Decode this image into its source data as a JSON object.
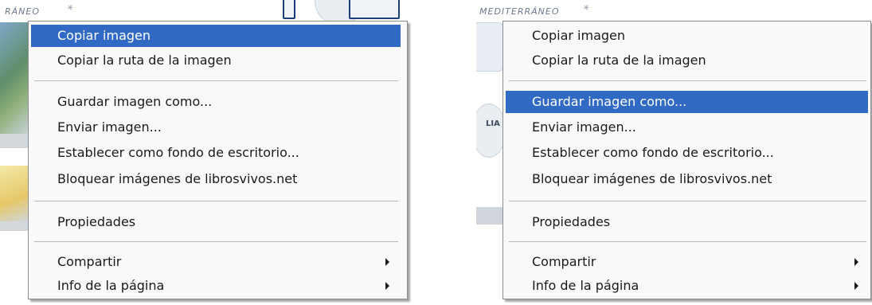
{
  "left_panel": {
    "caption": "RÁNEO",
    "menu": {
      "items": [
        {
          "label": "Copiar imagen",
          "highlighted": true,
          "submenu": false
        },
        {
          "label": "Copiar la ruta de la imagen",
          "highlighted": false,
          "submenu": false
        },
        {
          "label": "Guardar imagen como...",
          "highlighted": false,
          "submenu": false
        },
        {
          "label": "Enviar imagen...",
          "highlighted": false,
          "submenu": false
        },
        {
          "label": "Establecer como fondo de escritorio...",
          "highlighted": false,
          "submenu": false
        },
        {
          "label": "Bloquear imágenes de librosvivos.net",
          "highlighted": false,
          "submenu": false
        },
        {
          "label": "Propiedades",
          "highlighted": false,
          "submenu": false
        },
        {
          "label": "Compartir",
          "highlighted": false,
          "submenu": true
        },
        {
          "label": "Info de la página",
          "highlighted": false,
          "submenu": true
        }
      ]
    }
  },
  "right_panel": {
    "caption": "MEDITERRÁNEO",
    "side_text": "LIA",
    "menu": {
      "items": [
        {
          "label": "Copiar imagen",
          "highlighted": false,
          "submenu": false
        },
        {
          "label": "Copiar la ruta de la imagen",
          "highlighted": false,
          "submenu": false
        },
        {
          "label": "Guardar imagen como...",
          "highlighted": true,
          "submenu": false
        },
        {
          "label": "Enviar imagen...",
          "highlighted": false,
          "submenu": false
        },
        {
          "label": "Establecer como fondo de escritorio...",
          "highlighted": false,
          "submenu": false
        },
        {
          "label": "Bloquear imágenes de librosvivos.net",
          "highlighted": false,
          "submenu": false
        },
        {
          "label": "Propiedades",
          "highlighted": false,
          "submenu": false
        },
        {
          "label": "Compartir",
          "highlighted": false,
          "submenu": true
        },
        {
          "label": "Info de la página",
          "highlighted": false,
          "submenu": true
        }
      ]
    }
  },
  "colors": {
    "highlight": "#316ac5",
    "menu_background": "#f9f9f9",
    "menu_text": "#1a1a1a",
    "caption_text": "#6b7a8e"
  }
}
